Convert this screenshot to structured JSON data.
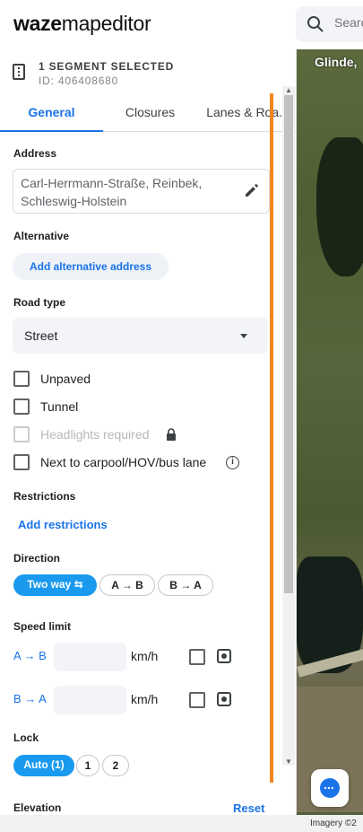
{
  "app": {
    "logo_bold": "waze",
    "logo_rest": "mapeditor"
  },
  "search": {
    "placeholder": "Search"
  },
  "map": {
    "place_label": "Glinde,",
    "imagery_credit": "Imagery ©2"
  },
  "segment": {
    "title": "1 SEGMENT SELECTED",
    "id": "ID: 406408680"
  },
  "tabs": [
    {
      "label": "General",
      "active": true
    },
    {
      "label": "Closures",
      "active": false
    },
    {
      "label": "Lanes & Roa...",
      "active": false
    }
  ],
  "address": {
    "label": "Address",
    "line1": "Carl-Herrmann-Straße, Reinbek,",
    "line2": "Schleswig-Holstein"
  },
  "alternative": {
    "label": "Alternative",
    "button": "Add alternative address"
  },
  "road_type": {
    "label": "Road type",
    "value": "Street"
  },
  "checkboxes": [
    {
      "label": "Unpaved",
      "checked": false,
      "disabled": false
    },
    {
      "label": "Tunnel",
      "checked": false,
      "disabled": false
    },
    {
      "label": "Headlights required",
      "checked": false,
      "disabled": true
    },
    {
      "label": "Next to carpool/HOV/bus lane",
      "checked": false,
      "disabled": false
    }
  ],
  "restrictions": {
    "label": "Restrictions",
    "link": "Add restrictions"
  },
  "direction": {
    "label": "Direction",
    "options": [
      "Two way",
      "A → B",
      "B → A"
    ],
    "selected": "Two way"
  },
  "speed_limit": {
    "label": "Speed limit",
    "rows": [
      {
        "dir": "A → B",
        "unit": "km/h",
        "value": ""
      },
      {
        "dir": "B → A",
        "unit": "km/h",
        "value": ""
      }
    ]
  },
  "lock": {
    "label": "Lock",
    "options": [
      "Auto (1)",
      "1",
      "2"
    ],
    "selected": "Auto (1)"
  },
  "elevation": {
    "label": "Elevation",
    "reset": "Reset"
  },
  "colors": {
    "accent": "#1a73e8",
    "chip_selected": "#1a9aef",
    "highlight_bar": "#f5851f"
  }
}
